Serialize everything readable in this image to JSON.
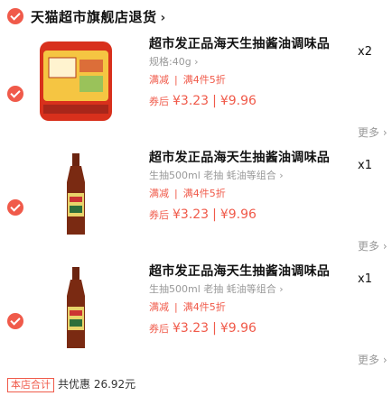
{
  "store": {
    "name": "天猫超市旗舰店退货",
    "chevron": "›"
  },
  "items": [
    {
      "title": "超市发正品海天生抽酱油调味品",
      "spec": "规格:40g ›",
      "promo_a": "满减",
      "promo_b": "满4件5折",
      "price_prefix": "券后",
      "price1": "¥3.23",
      "price2": "¥9.96",
      "qty": "x2",
      "more": "更多 ›"
    },
    {
      "title": "超市发正品海天生抽酱油调味品",
      "spec": "生抽500ml 老抽 蚝油等组合 ›",
      "promo_a": "满减",
      "promo_b": "满4件5折",
      "price_prefix": "券后",
      "price1": "¥3.23",
      "price2": "¥9.96",
      "qty": "x1",
      "more": "更多 ›"
    },
    {
      "title": "超市发正品海天生抽酱油调味品",
      "spec": "生抽500ml 老抽 蚝油等组合 ›",
      "promo_a": "满减",
      "promo_b": "满4件5折",
      "price_prefix": "券后",
      "price1": "¥3.23",
      "price2": "¥9.96",
      "qty": "x1",
      "more": "更多 ›"
    }
  ],
  "footer": {
    "tag": "本店合计",
    "text": "共优惠 26.92元"
  },
  "colors": {
    "accent": "#f05a4a"
  }
}
